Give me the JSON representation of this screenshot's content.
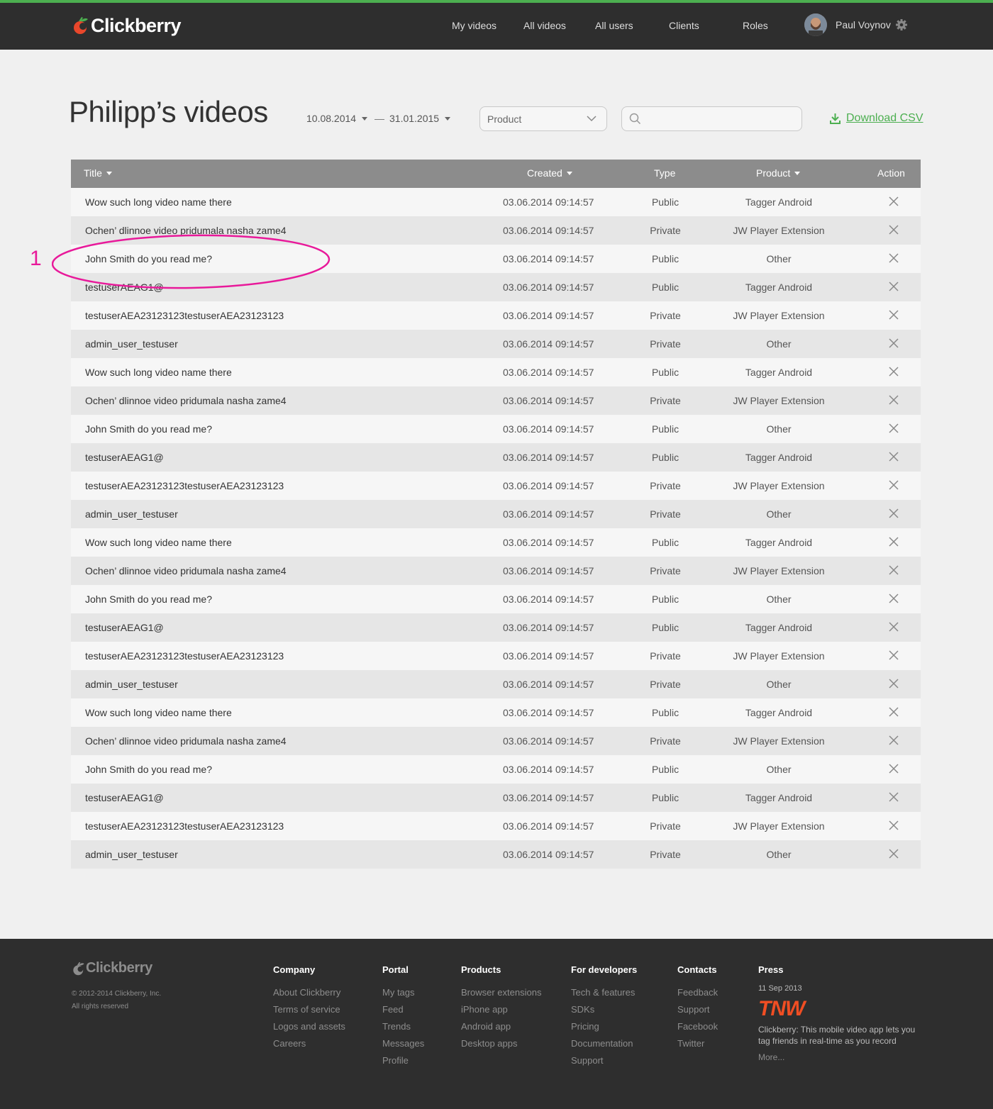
{
  "brand": {
    "name": "Clickberry",
    "accent": "#4caf50",
    "berry_color": "#e8472b"
  },
  "nav": {
    "items": [
      "My videos",
      "All videos",
      "All users",
      "Clients",
      "Roles"
    ],
    "user_name": "Paul Voynov"
  },
  "toolbar": {
    "title": "Philipp’s videos",
    "date_from": "10.08.2014",
    "date_sep": "—",
    "date_to": "31.01.2015",
    "product_select": "Product",
    "search_value": "",
    "download_label": "Download CSV"
  },
  "table": {
    "headers": {
      "title": "Title",
      "created": "Created",
      "type": "Type",
      "product": "Product",
      "action": "Action"
    },
    "rows": [
      {
        "title": "Wow such long video name there",
        "created": "03.06.2014  09:14:57",
        "type": "Public",
        "product": "Tagger Android"
      },
      {
        "title": "Ochen’ dlinnoe video pridumala nasha zame4",
        "created": "03.06.2014  09:14:57",
        "type": "Private",
        "product": "JW Player Extension"
      },
      {
        "title": "John Smith do you read me?",
        "created": "03.06.2014  09:14:57",
        "type": "Public",
        "product": "Other"
      },
      {
        "title": "testuserAEAG1@",
        "created": "03.06.2014  09:14:57",
        "type": "Public",
        "product": "Tagger Android"
      },
      {
        "title": "testuserAEA23123123testuserAEA23123123",
        "created": "03.06.2014  09:14:57",
        "type": "Private",
        "product": "JW Player Extension"
      },
      {
        "title": "admin_user_testuser",
        "created": "03.06.2014  09:14:57",
        "type": "Private",
        "product": "Other"
      },
      {
        "title": "Wow such long video name there",
        "created": "03.06.2014  09:14:57",
        "type": "Public",
        "product": "Tagger Android"
      },
      {
        "title": "Ochen’ dlinnoe video pridumala nasha zame4",
        "created": "03.06.2014  09:14:57",
        "type": "Private",
        "product": "JW Player Extension"
      },
      {
        "title": "John Smith do you read me?",
        "created": "03.06.2014  09:14:57",
        "type": "Public",
        "product": "Other"
      },
      {
        "title": "testuserAEAG1@",
        "created": "03.06.2014  09:14:57",
        "type": "Public",
        "product": "Tagger Android"
      },
      {
        "title": "testuserAEA23123123testuserAEA23123123",
        "created": "03.06.2014  09:14:57",
        "type": "Private",
        "product": "JW Player Extension"
      },
      {
        "title": "admin_user_testuser",
        "created": "03.06.2014  09:14:57",
        "type": "Private",
        "product": "Other"
      },
      {
        "title": "Wow such long video name there",
        "created": "03.06.2014  09:14:57",
        "type": "Public",
        "product": "Tagger Android"
      },
      {
        "title": "Ochen’ dlinnoe video pridumala nasha zame4",
        "created": "03.06.2014  09:14:57",
        "type": "Private",
        "product": "JW Player Extension"
      },
      {
        "title": "John Smith do you read me?",
        "created": "03.06.2014  09:14:57",
        "type": "Public",
        "product": "Other"
      },
      {
        "title": "testuserAEAG1@",
        "created": "03.06.2014  09:14:57",
        "type": "Public",
        "product": "Tagger Android"
      },
      {
        "title": "testuserAEA23123123testuserAEA23123123",
        "created": "03.06.2014  09:14:57",
        "type": "Private",
        "product": "JW Player Extension"
      },
      {
        "title": "admin_user_testuser",
        "created": "03.06.2014  09:14:57",
        "type": "Private",
        "product": "Other"
      },
      {
        "title": "Wow such long video name there",
        "created": "03.06.2014  09:14:57",
        "type": "Public",
        "product": "Tagger Android"
      },
      {
        "title": "Ochen’ dlinnoe video pridumala nasha zame4",
        "created": "03.06.2014  09:14:57",
        "type": "Private",
        "product": "JW Player Extension"
      },
      {
        "title": "John Smith do you read me?",
        "created": "03.06.2014  09:14:57",
        "type": "Public",
        "product": "Other"
      },
      {
        "title": "testuserAEAG1@",
        "created": "03.06.2014  09:14:57",
        "type": "Public",
        "product": "Tagger Android"
      },
      {
        "title": "testuserAEA23123123testuserAEA23123123",
        "created": "03.06.2014  09:14:57",
        "type": "Private",
        "product": "JW Player Extension"
      },
      {
        "title": "admin_user_testuser",
        "created": "03.06.2014  09:14:57",
        "type": "Private",
        "product": "Other"
      }
    ]
  },
  "annotation": {
    "number": "1",
    "color": "#e8199a"
  },
  "footer": {
    "copyright": "© 2012-2014 Clickberry, Inc.",
    "rights": "All rights reserved",
    "columns": [
      {
        "heading": "Company",
        "links": [
          "About Clickberry",
          "Terms of service",
          "Logos and assets",
          "Careers"
        ]
      },
      {
        "heading": "Portal",
        "links": [
          "My tags",
          "Feed",
          "Trends",
          "Messages",
          "Profile"
        ]
      },
      {
        "heading": "Products",
        "links": [
          "Browser extensions",
          "iPhone app",
          "Android app",
          "Desktop apps"
        ]
      },
      {
        "heading": "For developers",
        "links": [
          "Tech & features",
          "SDKs",
          "Pricing",
          "Documentation",
          "Support"
        ]
      },
      {
        "heading": "Contacts",
        "links": [
          "Feedback",
          "Support",
          "Facebook",
          "Twitter"
        ]
      }
    ],
    "press": {
      "heading": "Press",
      "date": "11 Sep 2013",
      "source": "TNW",
      "text": "Clickberry: This mobile video app lets you tag friends in real-time as you record",
      "more": "More..."
    }
  }
}
